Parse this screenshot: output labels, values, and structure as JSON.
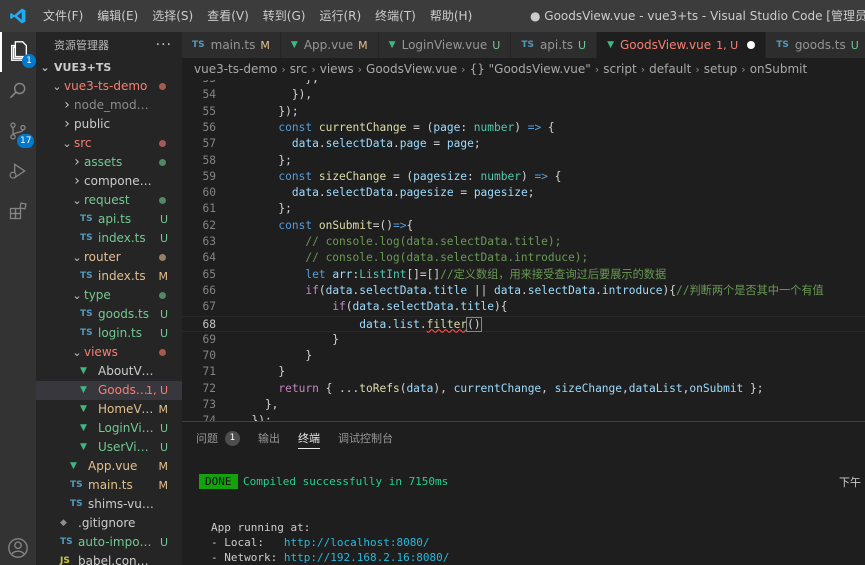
{
  "titlebar": {
    "menus": [
      "文件(F)",
      "编辑(E)",
      "选择(S)",
      "查看(V)",
      "转到(G)",
      "运行(R)",
      "终端(T)",
      "帮助(H)"
    ],
    "window_title": "● GoodsView.vue - vue3+ts - Visual Studio Code [管理员]"
  },
  "activitybar": {
    "explorer_badge": "1",
    "scm_badge": "17"
  },
  "explorer": {
    "title": "资源管理器",
    "more": "···",
    "workspace": "VUE3+TS",
    "items": [
      {
        "label": "vue3-ts-demo",
        "type": "folder-open",
        "depth": 1,
        "status": "err-dot"
      },
      {
        "label": "node_modules",
        "type": "folder",
        "depth": 2,
        "status": "",
        "dim": true
      },
      {
        "label": "public",
        "type": "folder",
        "depth": 2,
        "status": ""
      },
      {
        "label": "src",
        "type": "folder-open",
        "depth": 2,
        "status": "err-dot"
      },
      {
        "label": "assets",
        "type": "folder",
        "depth": 3,
        "status": "untr-dot"
      },
      {
        "label": "components",
        "type": "folder",
        "depth": 3,
        "status": ""
      },
      {
        "label": "request",
        "type": "folder-open",
        "depth": 3,
        "status": "untr-dot"
      },
      {
        "label": "api.ts",
        "type": "ts",
        "depth": 4,
        "status": "U"
      },
      {
        "label": "index.ts",
        "type": "ts",
        "depth": 4,
        "status": "U"
      },
      {
        "label": "router",
        "type": "folder-open",
        "depth": 3,
        "status": "mod-dot"
      },
      {
        "label": "index.ts",
        "type": "ts",
        "depth": 4,
        "status": "M"
      },
      {
        "label": "type",
        "type": "folder-open",
        "depth": 3,
        "status": "untr-dot"
      },
      {
        "label": "goods.ts",
        "type": "ts",
        "depth": 4,
        "status": "U"
      },
      {
        "label": "login.ts",
        "type": "ts",
        "depth": 4,
        "status": "U"
      },
      {
        "label": "views",
        "type": "folder-open",
        "depth": 3,
        "status": "err-dot"
      },
      {
        "label": "AboutView.vue",
        "type": "vue",
        "depth": 4,
        "status": ""
      },
      {
        "label": "GoodsVie...",
        "type": "vue",
        "depth": 4,
        "status": "1, U",
        "active": true
      },
      {
        "label": "HomeView....",
        "type": "vue",
        "depth": 4,
        "status": "M"
      },
      {
        "label": "LoginView.vue",
        "type": "vue",
        "depth": 4,
        "status": "U"
      },
      {
        "label": "UserView.vue",
        "type": "vue",
        "depth": 4,
        "status": "U"
      },
      {
        "label": "App.vue",
        "type": "vue",
        "depth": 3,
        "status": "M"
      },
      {
        "label": "main.ts",
        "type": "ts",
        "depth": 3,
        "status": "M"
      },
      {
        "label": "shims-vue.d.ts",
        "type": "ts",
        "depth": 3,
        "status": ""
      },
      {
        "label": ".gitignore",
        "type": "git",
        "depth": 2,
        "status": ""
      },
      {
        "label": "auto-imports.d.ts",
        "type": "ts",
        "depth": 2,
        "status": "U"
      },
      {
        "label": "babel.config.js",
        "type": "js",
        "depth": 2,
        "status": ""
      }
    ]
  },
  "tabs": [
    {
      "label": "main.ts",
      "icon": "TS",
      "badge": "M",
      "kind": "ts"
    },
    {
      "label": "App.vue",
      "icon": "V",
      "badge": "M",
      "kind": "vue"
    },
    {
      "label": "LoginView.vue",
      "icon": "V",
      "badge": "U",
      "kind": "vue"
    },
    {
      "label": "api.ts",
      "icon": "TS",
      "badge": "U",
      "kind": "ts"
    },
    {
      "label": "GoodsView.vue",
      "icon": "V",
      "badge": "1, U",
      "kind": "vue",
      "active": true
    },
    {
      "label": "goods.ts",
      "icon": "TS",
      "badge": "U",
      "kind": "ts"
    }
  ],
  "breadcrumb": [
    "vue3-ts-demo",
    "src",
    "views",
    "GoodsView.vue",
    "{} \"GoodsView.vue\"",
    "script",
    "default",
    "setup",
    "onSubmit"
  ],
  "editor": {
    "current_line": 68,
    "lines": [
      {
        "n": "53",
        "tokens": [
          [
            "p",
            "          "
          ],
          [
            "p",
            "},"
          ]
        ],
        "partial": true
      },
      {
        "n": "54",
        "tokens": [
          [
            "p",
            "        }),"
          ]
        ]
      },
      {
        "n": "55",
        "tokens": [
          [
            "p",
            "      });"
          ]
        ]
      },
      {
        "n": "56",
        "tokens": [
          [
            "p",
            "      "
          ],
          [
            "k",
            "const "
          ],
          [
            "f",
            "currentChange"
          ],
          [
            "p",
            " = ("
          ],
          [
            "v",
            "page"
          ],
          [
            "p",
            ": "
          ],
          [
            "t",
            "number"
          ],
          [
            "p",
            ") "
          ],
          [
            "k",
            "=>"
          ],
          [
            "p",
            " {"
          ]
        ]
      },
      {
        "n": "57",
        "tokens": [
          [
            "p",
            "        "
          ],
          [
            "v",
            "data"
          ],
          [
            "p",
            "."
          ],
          [
            "v",
            "selectData"
          ],
          [
            "p",
            "."
          ],
          [
            "v",
            "page"
          ],
          [
            "p",
            " = "
          ],
          [
            "v",
            "page"
          ],
          [
            "p",
            ";"
          ]
        ]
      },
      {
        "n": "58",
        "tokens": [
          [
            "p",
            "      };"
          ]
        ]
      },
      {
        "n": "59",
        "tokens": [
          [
            "p",
            "      "
          ],
          [
            "k",
            "const "
          ],
          [
            "f",
            "sizeChange"
          ],
          [
            "p",
            " = ("
          ],
          [
            "v",
            "pagesize"
          ],
          [
            "p",
            ": "
          ],
          [
            "t",
            "number"
          ],
          [
            "p",
            ") "
          ],
          [
            "k",
            "=>"
          ],
          [
            "p",
            " {"
          ]
        ]
      },
      {
        "n": "60",
        "tokens": [
          [
            "p",
            "        "
          ],
          [
            "v",
            "data"
          ],
          [
            "p",
            "."
          ],
          [
            "v",
            "selectData"
          ],
          [
            "p",
            "."
          ],
          [
            "v",
            "pagesize"
          ],
          [
            "p",
            " = "
          ],
          [
            "v",
            "pagesize"
          ],
          [
            "p",
            ";"
          ]
        ]
      },
      {
        "n": "61",
        "tokens": [
          [
            "p",
            "      };"
          ]
        ]
      },
      {
        "n": "62",
        "tokens": [
          [
            "p",
            "      "
          ],
          [
            "k",
            "const "
          ],
          [
            "f",
            "onSubmit"
          ],
          [
            "p",
            "=()"
          ],
          [
            "k",
            "=>"
          ],
          [
            "p",
            "{"
          ]
        ]
      },
      {
        "n": "63",
        "tokens": [
          [
            "p",
            "          "
          ],
          [
            "cm",
            "// console.log(data.selectData.title);"
          ]
        ]
      },
      {
        "n": "64",
        "tokens": [
          [
            "p",
            "          "
          ],
          [
            "cm",
            "// console.log(data.selectData.introduce);"
          ]
        ]
      },
      {
        "n": "65",
        "tokens": [
          [
            "p",
            "          "
          ],
          [
            "k",
            "let "
          ],
          [
            "v",
            "arr"
          ],
          [
            "p",
            ":"
          ],
          [
            "t",
            "ListInt"
          ],
          [
            "p",
            "[]=[]"
          ],
          [
            "cm",
            "//定义数组，用来接受查询过后要展示的数据"
          ]
        ]
      },
      {
        "n": "66",
        "tokens": [
          [
            "p",
            "          "
          ],
          [
            "kw",
            "if"
          ],
          [
            "p",
            "("
          ],
          [
            "v",
            "data"
          ],
          [
            "p",
            "."
          ],
          [
            "v",
            "selectData"
          ],
          [
            "p",
            "."
          ],
          [
            "v",
            "title"
          ],
          [
            "p",
            " || "
          ],
          [
            "v",
            "data"
          ],
          [
            "p",
            "."
          ],
          [
            "v",
            "selectData"
          ],
          [
            "p",
            "."
          ],
          [
            "v",
            "introduce"
          ],
          [
            "p",
            "){"
          ],
          [
            "cm",
            "//判断两个是否其中一个有值"
          ]
        ]
      },
      {
        "n": "67",
        "tokens": [
          [
            "p",
            "              "
          ],
          [
            "kw",
            "if"
          ],
          [
            "p",
            "("
          ],
          [
            "v",
            "data"
          ],
          [
            "p",
            "."
          ],
          [
            "v",
            "selectData"
          ],
          [
            "p",
            "."
          ],
          [
            "v",
            "title"
          ],
          [
            "p",
            "){"
          ]
        ]
      },
      {
        "n": "68",
        "tokens": [
          [
            "p",
            "                  "
          ],
          [
            "v",
            "data"
          ],
          [
            "p",
            "."
          ],
          [
            "v",
            "list"
          ],
          [
            "p",
            "."
          ],
          [
            "fsq",
            "filter"
          ],
          [
            "pc",
            "()"
          ]
        ]
      },
      {
        "n": "69",
        "tokens": [
          [
            "p",
            "              }"
          ]
        ]
      },
      {
        "n": "70",
        "tokens": [
          [
            "p",
            "          }"
          ]
        ]
      },
      {
        "n": "71",
        "tokens": [
          [
            "p",
            "      }"
          ]
        ]
      },
      {
        "n": "72",
        "tokens": [
          [
            "p",
            "      "
          ],
          [
            "kw",
            "return"
          ],
          [
            "p",
            " { ..."
          ],
          [
            "f",
            "toRefs"
          ],
          [
            "p",
            "("
          ],
          [
            "v",
            "data"
          ],
          [
            "p",
            "), "
          ],
          [
            "v",
            "currentChange"
          ],
          [
            "p",
            ", "
          ],
          [
            "v",
            "sizeChange"
          ],
          [
            "p",
            ","
          ],
          [
            "v",
            "dataList"
          ],
          [
            "p",
            ","
          ],
          [
            "v",
            "onSubmit"
          ],
          [
            "p",
            " };"
          ]
        ]
      },
      {
        "n": "73",
        "tokens": [
          [
            "p",
            "    },"
          ]
        ]
      },
      {
        "n": "74",
        "tokens": [
          [
            "p",
            "  });"
          ]
        ],
        "partial": true
      }
    ]
  },
  "panel": {
    "tabs": [
      {
        "label": "问题",
        "badge": "1"
      },
      {
        "label": "输出"
      },
      {
        "label": "终端",
        "active": true
      },
      {
        "label": "调试控制台"
      }
    ],
    "terminal": {
      "done": "DONE",
      "compiled": "Compiled successfully in 7150ms",
      "right": "下午",
      "app_running": "App running at:",
      "local_label": "- Local:   ",
      "local_url": "http://localhost:8080/",
      "network_label": "- Network: ",
      "network_url": "http://192.168.2.16:8080/"
    }
  },
  "colors": {
    "accent": "#007acc",
    "modified": "#e2c08d",
    "untracked": "#73c991",
    "error": "#f88070"
  }
}
